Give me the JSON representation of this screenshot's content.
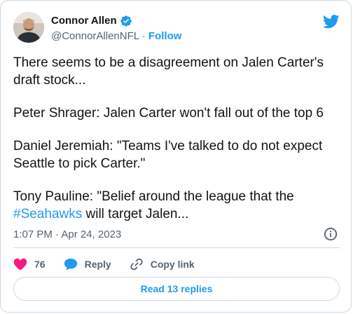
{
  "author": {
    "name": "Connor Allen",
    "handle": "@ConnorAllenNFL",
    "separator": "·",
    "follow_label": "Follow"
  },
  "tweet": {
    "paragraph1": "There seems to be a disagreement on Jalen Carter's draft stock...",
    "paragraph2": "Peter Shrager: Jalen Carter won't fall out of the top 6",
    "paragraph3": "Daniel Jeremiah: \"Teams I've talked to do not expect Seattle to pick Carter.\"",
    "paragraph4_before": "Tony Pauline: \"Belief around the league that the ",
    "hashtag": "#Seahawks",
    "paragraph4_after": " will target Jalen..."
  },
  "meta": {
    "timestamp": "1:07 PM · Apr 24, 2023"
  },
  "actions": {
    "like_count": "76",
    "reply_label": "Reply",
    "copy_link_label": "Copy link"
  },
  "footer": {
    "read_replies_label": "Read 13 replies"
  },
  "colors": {
    "brand_blue": "#1d9bf0",
    "like_pink": "#f91880",
    "secondary_text": "#536471"
  },
  "icons": [
    "verified-badge-icon",
    "twitter-bird-icon",
    "info-icon",
    "heart-icon",
    "reply-bubble-icon",
    "link-icon"
  ]
}
